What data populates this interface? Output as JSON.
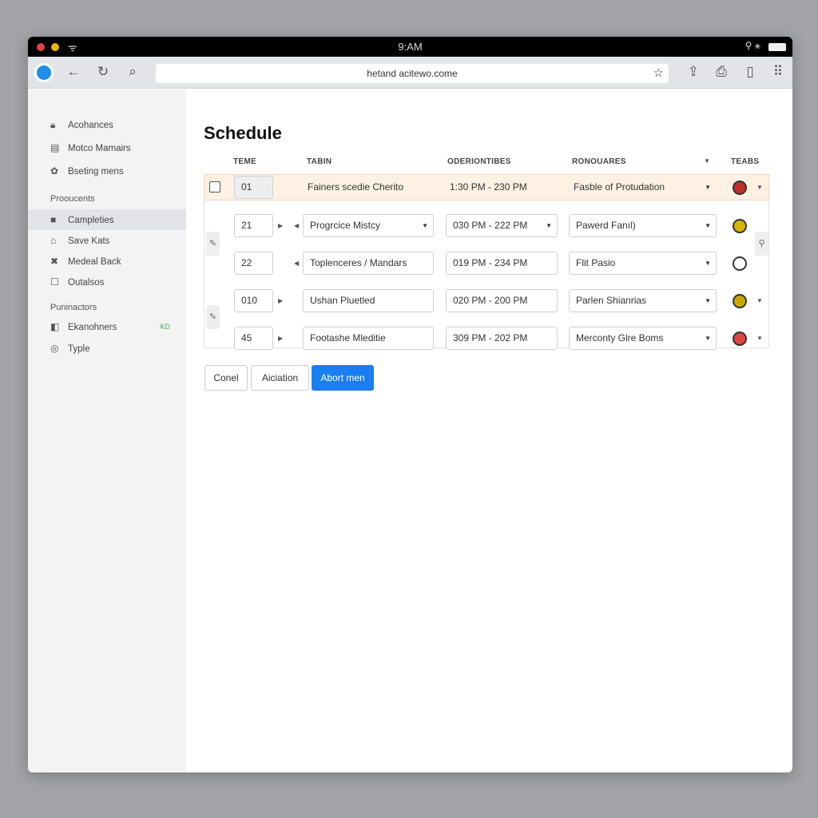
{
  "status_bar": {
    "time": "9:AM",
    "colors": {
      "red": "#e0443e",
      "yellow": "#f2b400"
    }
  },
  "browser": {
    "url": "hetand acitewo.come",
    "icons": [
      "globe-icon",
      "back-icon",
      "reload-icon",
      "pin-icon",
      "star-icon",
      "share-icon",
      "upload-icon",
      "tablet-icon",
      "grip-icon"
    ]
  },
  "sidebar": {
    "items": [
      {
        "label": "Acohances",
        "icon": "lock-icon"
      },
      {
        "label": "Motco Mamairs",
        "icon": "card-icon"
      },
      {
        "label": "Bseting mens",
        "icon": "tree-icon"
      }
    ],
    "section1": "Proouсents",
    "items2": [
      {
        "label": "Campleties",
        "icon": "bag-icon",
        "active": true
      },
      {
        "label": "Save Kats",
        "icon": "basket-icon"
      },
      {
        "label": "Medeal Back",
        "icon": "cross-icon"
      },
      {
        "label": "Outalsos",
        "icon": "square-icon"
      }
    ],
    "section2": "Puninactors",
    "items3": [
      {
        "label": "Ekanohners",
        "icon": "panel-icon",
        "badge": "KD"
      },
      {
        "label": "Typle",
        "icon": "circle-icon"
      }
    ]
  },
  "main": {
    "title": "Schedule",
    "columns": [
      "TEME",
      "TABIN",
      "ODERIONTIBES",
      "RONOUARES",
      "TEABS"
    ],
    "rows": [
      {
        "id": "01",
        "task": "Fainers scedie Cherito",
        "time": "1:30 PM  - 230 PM",
        "team": "Fasble of Protudation",
        "badge_color": "#c0302a"
      },
      {
        "id": "21",
        "task": "Progrcice Mistcy",
        "time": "030 PM  - 222 PM",
        "team": "Pawerd Fanıl)",
        "badge_color": "#d9b400"
      },
      {
        "id": "22",
        "task": "Toplenceres / Mandars",
        "time": "019 PM  - 234 PM",
        "team": "Flit Pasio",
        "badge_color": "#ffffff"
      },
      {
        "id": "010",
        "task": "Ushan Pluetled",
        "time": "020 PM  - 200 PM",
        "team": "Parlen Shianrias",
        "badge_color": "#c8a800"
      },
      {
        "id": "45",
        "task": "Footashe Mleditie",
        "time": "309 PM  - 202 PM",
        "team": "Merconty Glre Boms",
        "badge_color": "#e04545"
      }
    ],
    "buttons": {
      "cancel": "Conel",
      "action": "Aiciation",
      "primary": "Abort men"
    },
    "accent": "#1a7ef0"
  }
}
